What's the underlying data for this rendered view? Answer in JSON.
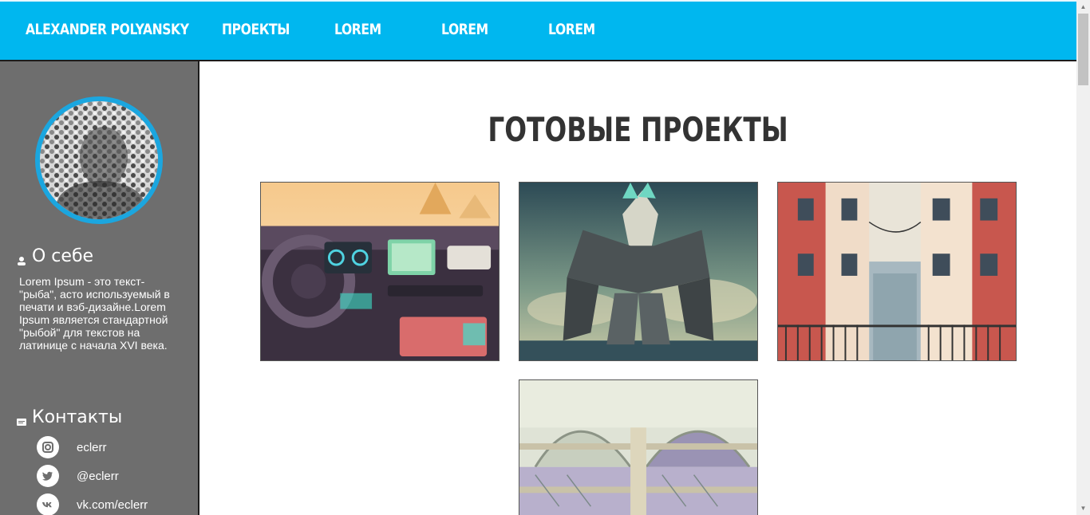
{
  "nav": {
    "brand": "ALEXANDER POLYANSKY",
    "items": [
      "ПРОЕКТЫ",
      "LOREM",
      "LOREM",
      "LOREM"
    ]
  },
  "sidebar": {
    "about_title": "О себе",
    "about_text": "Lorem Ipsum - это текст-\"рыба\", асто используемый в печати и вэб-дизайне.Lorem Ipsum является стандартной \"рыбой\" для текстов на латинице с начала XVI века.",
    "contacts_title": "Контакты",
    "contacts": [
      {
        "icon": "instagram-icon",
        "text": "eclerr"
      },
      {
        "icon": "twitter-icon",
        "text": "@eclerr"
      },
      {
        "icon": "vk-icon",
        "text": "vk.com/eclerr"
      }
    ]
  },
  "main": {
    "title": "ГОТОВЫЕ ПРОЕКТЫ",
    "projects": [
      {
        "name": "car-dashboard-illustration"
      },
      {
        "name": "robot-illustration"
      },
      {
        "name": "houses-illustration"
      },
      {
        "name": "arch-building-illustration"
      }
    ]
  },
  "colors": {
    "accent": "#00b7ef",
    "sidebar": "#6e6e6e",
    "avatar_border": "#1ba6df"
  }
}
